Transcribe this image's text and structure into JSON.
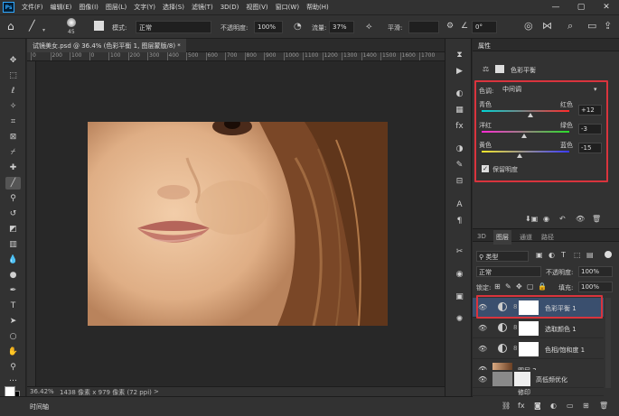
{
  "app": {
    "logo": "Ps"
  },
  "menu": [
    "文件(F)",
    "编辑(E)",
    "图像(I)",
    "图层(L)",
    "文字(Y)",
    "选择(S)",
    "滤镜(T)",
    "3D(D)",
    "视图(V)",
    "窗口(W)",
    "帮助(H)"
  ],
  "options": {
    "brush_size": "45",
    "mode_label": "模式:",
    "mode_value": "正常",
    "opacity_label": "不透明度:",
    "opacity_value": "100%",
    "flow_label": "流量:",
    "flow_value": "37%",
    "smooth_label": "平滑:",
    "angle_value": "0°"
  },
  "document": {
    "tab_title": "试镜美女.psd @ 36.4% (色彩平衡 1, 图层蒙版/8) *",
    "ruler_ticks": [
      "0",
      "200",
      "100",
      "0",
      "100",
      "200",
      "300",
      "400",
      "500",
      "600",
      "700",
      "800",
      "900",
      "1000",
      "1100",
      "1200",
      "1300",
      "1400",
      "1500",
      "1600",
      "1700"
    ]
  },
  "status": {
    "zoom": "36.42%",
    "size": "1438 像素 x 979 像素 (72 ppi)",
    "arrow": ">"
  },
  "timeline": {
    "label": "时间轴"
  },
  "properties": {
    "title": "属性",
    "adjustment_name": "色彩平衡",
    "tone_label": "色调:",
    "tone_value": "中间调",
    "sliders": [
      {
        "left": "青色",
        "right": "红色",
        "value": "+12",
        "position": 0.56
      },
      {
        "left": "洋红",
        "right": "绿色",
        "value": "-3",
        "position": 0.48
      },
      {
        "left": "黄色",
        "right": "蓝色",
        "value": "-15",
        "position": 0.43
      }
    ],
    "preserve_luminosity": "保留明度",
    "preserve_checked": true
  },
  "layers_panel": {
    "tabs": [
      "3D",
      "图层",
      "通道",
      "路径"
    ],
    "active_tab": "图层",
    "filter_label": "类型",
    "blend_mode": "正常",
    "opacity_label": "不透明度:",
    "opacity_value": "100%",
    "lock_label": "锁定:",
    "fill_label": "填充:",
    "fill_value": "100%",
    "layers": [
      {
        "name": "色彩平衡 1",
        "type": "adjustment",
        "selected": true
      },
      {
        "name": "选取颜色 1",
        "type": "adjustment",
        "selected": false
      },
      {
        "name": "色相/饱和度 1",
        "type": "adjustment",
        "selected": false
      },
      {
        "name": "图层 2",
        "type": "image",
        "selected": false
      },
      {
        "name": "高低频优化",
        "type": "group",
        "selected": false
      },
      {
        "name": "修印",
        "type": "group",
        "selected": false
      }
    ]
  },
  "colors": {
    "highlight": "#d9343d",
    "accent": "#31a8ff",
    "selected_layer": "#3a4f6e"
  }
}
